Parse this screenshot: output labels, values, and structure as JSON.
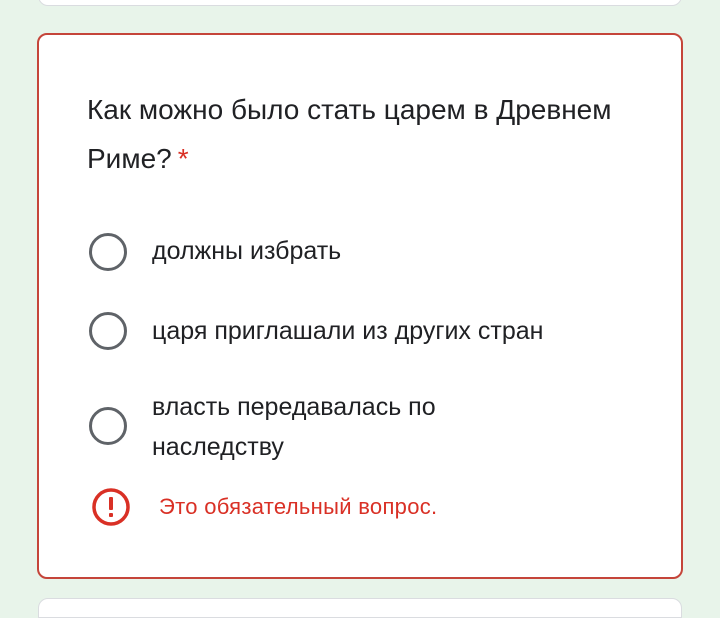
{
  "question": {
    "text": "Как можно было стать царем в Древнем Риме?",
    "required_marker": "*"
  },
  "options": [
    {
      "label": "должны избрать"
    },
    {
      "label": "царя приглашали из других стран"
    },
    {
      "label": "власть передавалась по наследству"
    }
  ],
  "error": {
    "icon": "exclamation-circle-icon",
    "text": "Это обязательный вопрос."
  },
  "colors": {
    "background": "#e8f4ea",
    "error": "#d93025",
    "card_border_error": "#c5453a",
    "radio": "#5f6368",
    "text": "#202124"
  }
}
